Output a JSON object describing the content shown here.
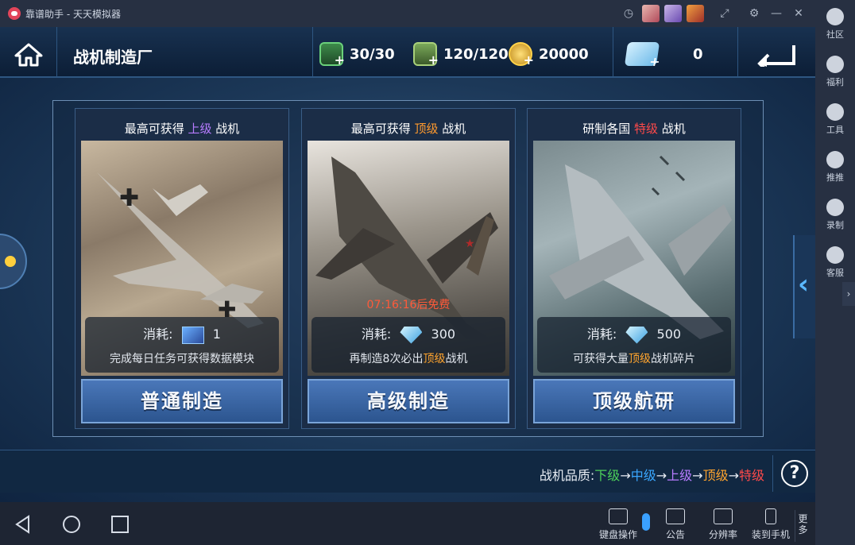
{
  "titlebar": {
    "title": "靠谱助手 - 天天模拟器"
  },
  "sidepanel": {
    "items": [
      {
        "label": "社区",
        "icon": "community-icon"
      },
      {
        "label": "福利",
        "icon": "gift-icon"
      },
      {
        "label": "工具",
        "icon": "tools-icon"
      },
      {
        "label": "推推",
        "icon": "tv-icon"
      },
      {
        "label": "录制",
        "icon": "camera-icon"
      },
      {
        "label": "客服",
        "icon": "support-icon"
      }
    ]
  },
  "game": {
    "page_title": "战机制造厂",
    "resources": {
      "stamina": "30/30",
      "fuel": "120/120",
      "gold": "20000",
      "diamonds": "0"
    },
    "cards": [
      {
        "head_prefix": "最高可获得",
        "head_grade": "上级",
        "head_grade_color": "#b77cff",
        "head_suffix": "战机",
        "cost_label": "消耗:",
        "cost_value": "1",
        "note_prefix": "完成每日任务可获得数据模块",
        "note_grade": "",
        "note_suffix": "",
        "timer": "",
        "button": "普通制造"
      },
      {
        "head_prefix": "最高可获得",
        "head_grade": "顶级",
        "head_grade_color": "#ff9a2e",
        "head_suffix": "战机",
        "cost_label": "消耗:",
        "cost_value": "300",
        "note_prefix": "再制造8次必出",
        "note_grade": "顶级",
        "note_suffix": "战机",
        "timer": "07:16:16后免费",
        "button": "高级制造"
      },
      {
        "head_prefix": "研制各国",
        "head_grade": "特级",
        "head_grade_color": "#ff4a4a",
        "head_suffix": "战机",
        "cost_label": "消耗:",
        "cost_value": "500",
        "note_prefix": "可获得大量",
        "note_grade": "顶级",
        "note_suffix": "战机碎片",
        "timer": "",
        "button": "顶级航研"
      }
    ],
    "quality": {
      "label": "战机品质:",
      "levels": [
        {
          "name": "下级",
          "color": "#4ccf5a"
        },
        {
          "name": "中级",
          "color": "#3aa7ff"
        },
        {
          "name": "上级",
          "color": "#b77cff"
        },
        {
          "name": "顶级",
          "color": "#ffa42e"
        },
        {
          "name": "特级",
          "color": "#ff4a4a"
        }
      ],
      "arrow": "→"
    },
    "help": "?"
  },
  "navbar": {
    "tools": [
      {
        "label": "键盘操作",
        "icon": "keyboard-icon"
      },
      {
        "label": "公告",
        "icon": "announcement-icon"
      },
      {
        "label": "分辨率",
        "icon": "resolution-icon"
      },
      {
        "label": "装到手机",
        "icon": "phone-icon"
      }
    ],
    "more": "更多"
  }
}
